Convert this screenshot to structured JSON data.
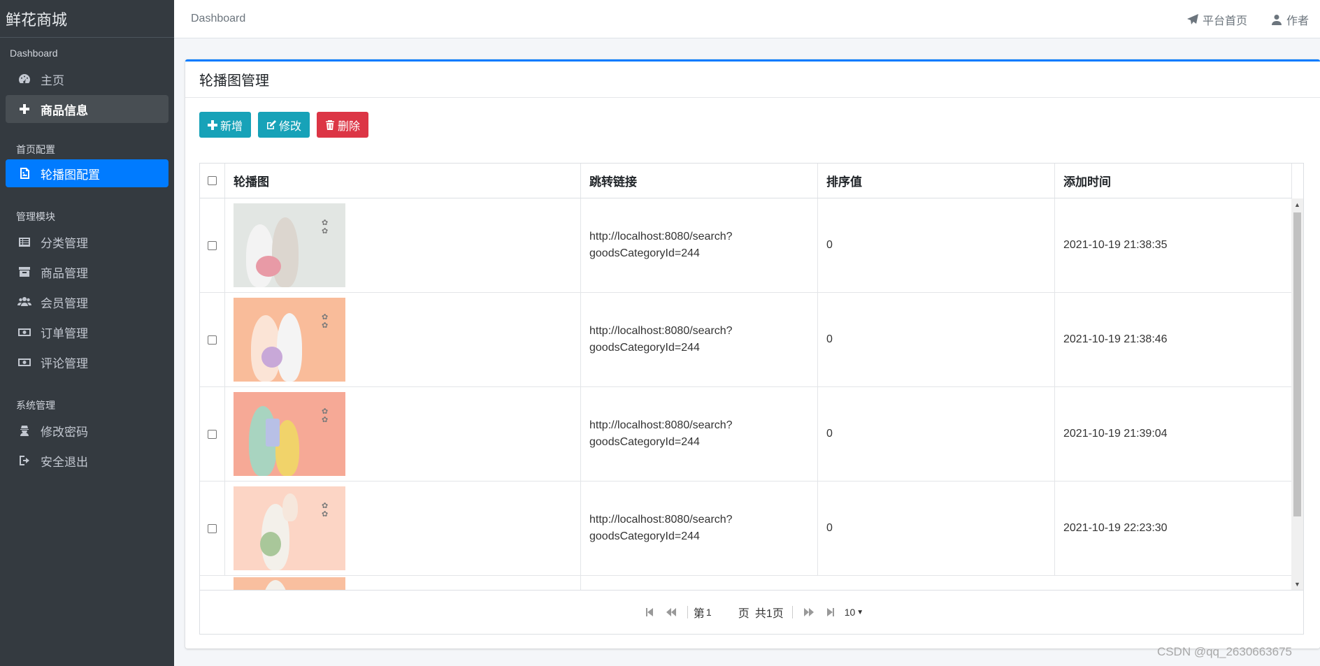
{
  "app": {
    "brand": "鲜花商城"
  },
  "sidebar": {
    "sections": [
      {
        "header": "Dashboard",
        "items": [
          {
            "label": "主页",
            "icon": "dashboard-icon"
          },
          {
            "label": "商品信息",
            "icon": "plus-icon"
          }
        ]
      },
      {
        "header": "首页配置",
        "items": [
          {
            "label": "轮播图配置",
            "icon": "image-icon"
          }
        ]
      },
      {
        "header": "管理模块",
        "items": [
          {
            "label": "分类管理",
            "icon": "list-icon"
          },
          {
            "label": "商品管理",
            "icon": "archive-icon"
          },
          {
            "label": "会员管理",
            "icon": "users-icon"
          },
          {
            "label": "订单管理",
            "icon": "money-icon"
          },
          {
            "label": "评论管理",
            "icon": "money-icon"
          }
        ]
      },
      {
        "header": "系统管理",
        "items": [
          {
            "label": "修改密码",
            "icon": "user-secret-icon"
          },
          {
            "label": "安全退出",
            "icon": "sign-out-icon"
          }
        ]
      }
    ]
  },
  "topbar": {
    "breadcrumb": "Dashboard",
    "links": [
      {
        "label": "平台首页",
        "icon": "paper-plane-icon"
      },
      {
        "label": "作者",
        "icon": "user-icon"
      }
    ]
  },
  "card": {
    "title": "轮播图管理",
    "buttons": {
      "add": "新增",
      "edit": "修改",
      "delete": "删除"
    }
  },
  "table": {
    "columns": [
      "轮播图",
      "跳转链接",
      "排序值",
      "添加时间"
    ],
    "rows": [
      {
        "link1": "http://localhost:8080/search?",
        "link2": "goodsCategoryId=244",
        "sort": "0",
        "time": "2021-10-19 21:38:35",
        "img_bg": "#e2e6e3"
      },
      {
        "link1": "http://localhost:8080/search?",
        "link2": "goodsCategoryId=244",
        "sort": "0",
        "time": "2021-10-19 21:38:46",
        "img_bg": "#f9bc9a"
      },
      {
        "link1": "http://localhost:8080/search?",
        "link2": "goodsCategoryId=244",
        "sort": "0",
        "time": "2021-10-19 21:39:04",
        "img_bg": "#f6a996"
      },
      {
        "link1": "http://localhost:8080/search?",
        "link2": "goodsCategoryId=244",
        "sort": "0",
        "time": "2021-10-19 22:23:30",
        "img_bg": "#fcd5c5"
      }
    ],
    "partial_row_img_bg": "#f9bf9f"
  },
  "pager": {
    "page_prefix": "第",
    "page_value": "1",
    "page_suffix": "页",
    "total": "共1页",
    "page_size": "10"
  },
  "watermark": "CSDN @qq_2630663675",
  "colors": {
    "sidebar_bg": "#343a40",
    "primary": "#007bff",
    "info": "#17a2b8",
    "danger": "#dc3545"
  }
}
